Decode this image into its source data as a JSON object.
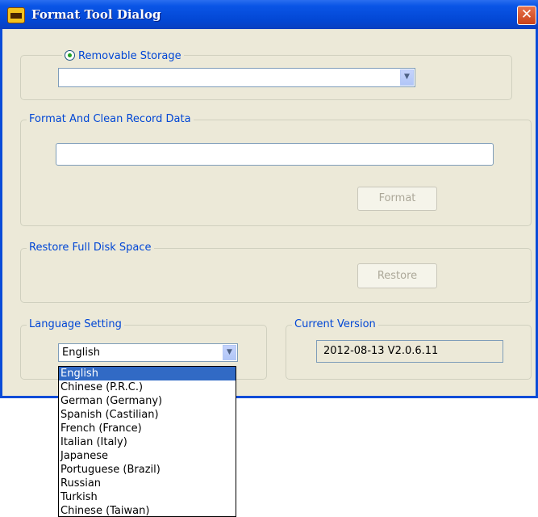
{
  "window": {
    "title": "Format Tool Dialog",
    "close_glyph": "✕",
    "icon": "app-icon"
  },
  "storage": {
    "radio_label": "Removable Storage",
    "radio_selected": true,
    "device_value": ""
  },
  "format_group": {
    "legend": "Format And Clean Record Data",
    "text_value": "",
    "button_label": "Format"
  },
  "restore_group": {
    "legend": "Restore Full Disk Space",
    "button_label": "Restore"
  },
  "language_group": {
    "legend": "Language Setting",
    "selected": "English",
    "options": [
      "English",
      "Chinese (P.R.C.)",
      "German (Germany)",
      "Spanish (Castilian)",
      "French (France)",
      "Italian (Italy)",
      "Japanese",
      "Portuguese (Brazil)",
      "Russian",
      "Turkish",
      "Chinese (Taiwan)"
    ]
  },
  "version_group": {
    "legend": "Current Version",
    "value": "2012-08-13 V2.0.6.11"
  },
  "colors": {
    "title_bar": "#0a55e6",
    "dialog_bg": "#ece9d8",
    "legend_text": "#0046d5",
    "selection": "#316ac5"
  }
}
